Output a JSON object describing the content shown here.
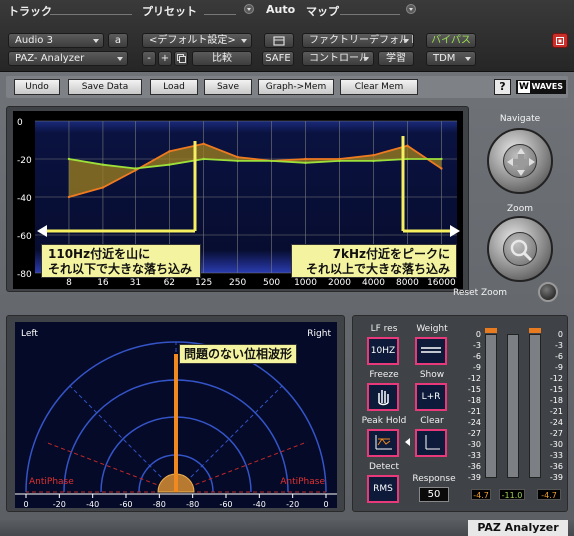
{
  "host": {
    "track_header": "トラック",
    "preset_header": "プリセット",
    "auto_header": "Auto",
    "map_header": "マップ",
    "track_name": "Audio 3",
    "track_letter": "a",
    "plugin_select": "PAZ- Analyzer",
    "preset_value": "<デフォルト設定>",
    "compare_label": "比較",
    "minus_label": "-",
    "plus_label": "+",
    "safe_label": "SAFE",
    "map_value": "ファクトリーデフォルト",
    "bypass_label": "バイパス",
    "control_value": "コントロール",
    "learn_label": "学習",
    "tdm_value": "TDM"
  },
  "toolbar": {
    "undo": "Undo",
    "save_data": "Save Data",
    "load": "Load",
    "save": "Save",
    "graph_mem": "Graph->Mem",
    "clear_mem": "Clear Mem",
    "help": "?",
    "waves_logo": "WAVES"
  },
  "frequency_graph": {
    "y_ticks": [
      "0",
      "-20",
      "-40",
      "-60",
      "-80"
    ],
    "x_ticks": [
      "8",
      "16",
      "31",
      "62",
      "125",
      "250",
      "500",
      "1000",
      "2000",
      "4000",
      "8000",
      "16000"
    ]
  },
  "chart_data": {
    "type": "line",
    "x": [
      8,
      16,
      31,
      62,
      125,
      250,
      500,
      1000,
      2000,
      4000,
      8000,
      16000
    ],
    "series": [
      {
        "values": [
          -40,
          -35,
          -26,
          -16,
          -12,
          -19,
          -21,
          -20,
          -20,
          -18,
          -13,
          -25
        ]
      },
      {
        "values": [
          -20,
          -23,
          -25,
          -23,
          -20,
          -21,
          -21,
          -22,
          -21,
          -21,
          -20,
          -20
        ]
      }
    ],
    "xlabel": "",
    "ylabel": "",
    "ylim": [
      -80,
      0
    ],
    "x_scale": "log"
  },
  "annotations": {
    "left_callout_line1": "110Hz付近を山に",
    "left_callout_line2": "それ以下で大きな落ち込み",
    "right_callout_line1": "7kHz付近をピークに",
    "right_callout_line2": "それ以上で大きな落ち込み",
    "phase_callout": "問題のない位相波形"
  },
  "side": {
    "navigate_label": "Navigate",
    "zoom_label": "Zoom",
    "reset_zoom_label": "Reset Zoom"
  },
  "phase": {
    "left_label": "Left",
    "right_label": "Right",
    "antiphase_left": "AntiPhase",
    "antiphase_right": "AntiPhase",
    "x_ticks": [
      "0",
      "-20",
      "-40",
      "-60",
      "-80",
      "-80",
      "-60",
      "-40",
      "-20",
      "0"
    ]
  },
  "controls": {
    "lf_res_label": "LF res",
    "lf_res_value": "10HZ",
    "weight_label": "Weight",
    "freeze_label": "Freeze",
    "show_label": "Show",
    "show_value": "L+R",
    "peak_hold_label": "Peak Hold",
    "clear_label": "Clear",
    "detect_label": "Detect",
    "detect_value": "RMS",
    "response_label": "Response",
    "response_value": "50"
  },
  "meters": {
    "scale": [
      "0",
      "-3",
      "-6",
      "-9",
      "-12",
      "-15",
      "-18",
      "-21",
      "-24",
      "-27",
      "-30",
      "-33",
      "-36",
      "-39"
    ],
    "left_readout": "-4.7",
    "center_readout": "-11.0",
    "right_readout": "-4.7",
    "readout_colors": {
      "peak": "#f0a030",
      "center": "#9bd34e"
    }
  },
  "footer": {
    "plugin_name": "PAZ Analyzer"
  }
}
